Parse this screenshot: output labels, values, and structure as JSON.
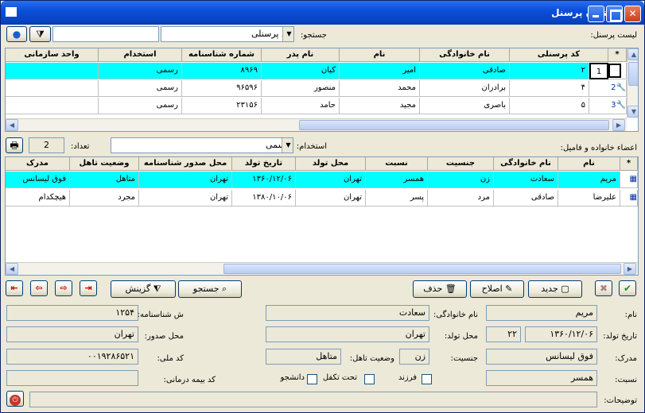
{
  "window": {
    "title": "بستگان پرسنل"
  },
  "top": {
    "personnel_list_label": "لیست پرسنل:",
    "search_label": "جستجو:",
    "search_field_value": "کد پرسنلی",
    "search_text": ""
  },
  "personnel_grid": {
    "columns": [
      "*",
      "کد پرسنلی",
      "نام خانوادگی",
      "نام",
      "نام پدر",
      "شماره شناسنامه",
      "استخدام",
      "واحد سازمانی"
    ],
    "rows": [
      {
        "indicator": "1",
        "code": "۲",
        "family": "صادقی",
        "name": "امیر",
        "father": "کیان",
        "idno": "۸۹۶۹",
        "employment": "رسمی",
        "unit": ""
      },
      {
        "indicator": "2",
        "code": "۴",
        "family": "برادران",
        "name": "محمد",
        "father": "منصور",
        "idno": "۹۶۵۹۶",
        "employment": "رسمی",
        "unit": ""
      },
      {
        "indicator": "3",
        "code": "۵",
        "family": "باصری",
        "name": "مجید",
        "father": "حامد",
        "idno": "۲۳۱۵۶",
        "employment": "رسمی",
        "unit": ""
      }
    ]
  },
  "mid": {
    "family_label": "اعضاء خانواده و فامیل:",
    "employment_label": "استخدام:",
    "employment_value": "رسمی",
    "count_label": "تعداد:",
    "count_value": "2"
  },
  "family_grid": {
    "columns": [
      "*",
      "نام",
      "نام خانوادگی",
      "جنسیت",
      "نسبت",
      "محل تولد",
      "تاریخ تولد",
      "محل صدور شناسنامه",
      "وضعیت تاهل",
      "مدرک"
    ],
    "rows": [
      {
        "name": "مریم",
        "family": "سعادت",
        "gender": "زن",
        "relation": "همسر",
        "birthplace": "تهران",
        "birthdate": "۱۳۶۰/۱۲/۰۶",
        "issue": "تهران",
        "marital": "متاهل",
        "degree": "فوق لیسانس"
      },
      {
        "name": "علیرضا",
        "family": "صادقی",
        "gender": "مرد",
        "relation": "پسر",
        "birthplace": "تهران",
        "birthdate": "۱۳۸۰/۱۰/۰۶",
        "issue": "تهران",
        "marital": "مجرد",
        "degree": "هیچکدام"
      }
    ]
  },
  "toolbar": {
    "search": "جستجو",
    "filter": "گزینش",
    "new": "جدید",
    "edit": "اصلاح",
    "delete": "حذف"
  },
  "form": {
    "name_label": "نام:",
    "name": "مریم",
    "family_label": "نام خانوادگی:",
    "family": "سعادت",
    "idno_label": "ش شناسنامه:",
    "idno": "۱۲۵۴",
    "birthdate_label": "تاریخ تولد:",
    "birthdate": "۱۳۶۰/۱۲/۰۶",
    "age": "۲۲",
    "birthplace_label": "محل تولد:",
    "birthplace": "تهران",
    "issue_label": "محل صدور:",
    "issue": "تهران",
    "degree_label": "مدرک:",
    "degree": "فوق لیسانس",
    "gender_label": "جنسیت:",
    "gender": "زن",
    "marital_label": "وضعیت تاهل:",
    "marital": "متاهل",
    "national_label": "کد ملی:",
    "national": "۰۰۱۹۲۸۶۵۲۱",
    "relation_label": "نسبت:",
    "relation": "همسر",
    "child_label": "فرزند",
    "dependent_label": "تحت تکفل",
    "student_label": "دانشجو",
    "insurance_label": "کد بیمه درمانی:",
    "insurance": "",
    "notes_label": "توضیحات:",
    "notes": ""
  }
}
